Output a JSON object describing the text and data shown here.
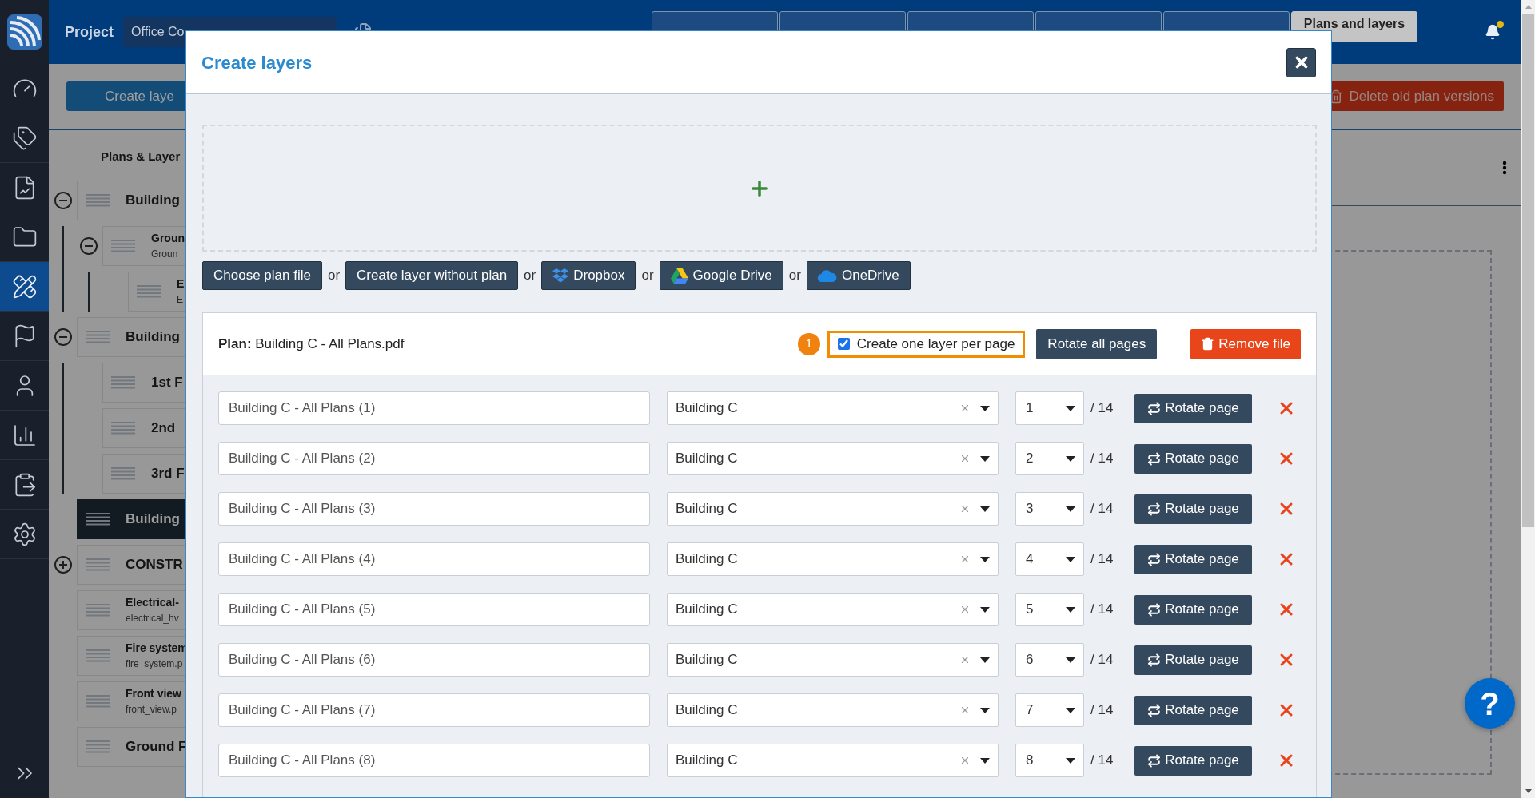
{
  "nav": {
    "items": [
      {
        "kind": "dashboard",
        "selected": false
      },
      {
        "kind": "tags",
        "selected": false
      },
      {
        "kind": "report",
        "selected": false
      },
      {
        "kind": "folder",
        "selected": false
      },
      {
        "kind": "plans",
        "selected": true
      },
      {
        "kind": "flag",
        "selected": false
      },
      {
        "kind": "user",
        "selected": false
      },
      {
        "kind": "chart",
        "selected": false
      },
      {
        "kind": "clipboard",
        "selected": false
      },
      {
        "kind": "settings",
        "selected": false
      }
    ]
  },
  "topbar": {
    "project_label": "Project",
    "project_value": "Office Co",
    "tabs": [
      {
        "selected": false
      },
      {
        "selected": false
      },
      {
        "selected": false
      },
      {
        "selected": false
      },
      {
        "selected": false
      },
      {
        "label": "Plans and layers",
        "selected": true
      }
    ],
    "notification": {
      "unread": true
    }
  },
  "toolbar": {
    "create_button": "Create laye",
    "delete_button": "Delete old plan versions"
  },
  "tree": {
    "title": "Plans & Layer",
    "items": [
      {
        "title": "Building",
        "selected": false,
        "expanded": true,
        "children": [
          {
            "title": "Groun",
            "subtitle": "Groun",
            "selected": false,
            "expanded": true,
            "children": [
              {
                "title": "E",
                "subtitle": "E",
                "selected": false
              }
            ]
          }
        ]
      },
      {
        "title": "Building",
        "selected": false,
        "expanded": true,
        "children": [
          {
            "title": "1st F",
            "selected": false
          },
          {
            "title": "2nd",
            "selected": false
          },
          {
            "title": "3rd F",
            "selected": false
          }
        ]
      },
      {
        "title": "Building",
        "selected": true
      },
      {
        "title": "CONSTR",
        "selected": false,
        "expanded": false
      },
      {
        "title": "Electrical-",
        "subtitle": "electrical_hv",
        "selected": false
      },
      {
        "title": "Fire system",
        "subtitle": "fire_system.p",
        "selected": false
      },
      {
        "title": "Front view",
        "subtitle": "front_view.p",
        "selected": false
      },
      {
        "title": "Ground F",
        "selected": false
      }
    ]
  },
  "modal": {
    "title": "Create layers",
    "sources": [
      {
        "kind": "file",
        "label": "Choose plan file"
      },
      {
        "kind": "blank",
        "label": "Create layer without plan",
        "prefix": "or"
      },
      {
        "kind": "dropbox",
        "label": "Dropbox",
        "prefix": "or"
      },
      {
        "kind": "gdrive",
        "label": "Google Drive",
        "prefix": "or"
      },
      {
        "kind": "onedrive",
        "label": "OneDrive",
        "prefix": "or"
      }
    ],
    "plan": {
      "label": "**Plan:** Building C - All Plans.pdf",
      "step_badge": "1",
      "one_layer_per_page": {
        "label": "Create one layer per page",
        "checked": true,
        "highlighted": true
      },
      "rotate_all": "Rotate all pages",
      "remove": "Remove file",
      "rows": [
        {
          "name": "Building C - All Plans (1)",
          "layer": "Building C",
          "page": "1",
          "total": "/ 14",
          "rotate": "Rotate page"
        },
        {
          "name": "Building C - All Plans (2)",
          "layer": "Building C",
          "page": "2",
          "total": "/ 14",
          "rotate": "Rotate page"
        },
        {
          "name": "Building C - All Plans (3)",
          "layer": "Building C",
          "page": "3",
          "total": "/ 14",
          "rotate": "Rotate page"
        },
        {
          "name": "Building C - All Plans (4)",
          "layer": "Building C",
          "page": "4",
          "total": "/ 14",
          "rotate": "Rotate page"
        },
        {
          "name": "Building C - All Plans (5)",
          "layer": "Building C",
          "page": "5",
          "total": "/ 14",
          "rotate": "Rotate page"
        },
        {
          "name": "Building C - All Plans (6)",
          "layer": "Building C",
          "page": "6",
          "total": "/ 14",
          "rotate": "Rotate page"
        },
        {
          "name": "Building C - All Plans (7)",
          "layer": "Building C",
          "page": "7",
          "total": "/ 14",
          "rotate": "Rotate page"
        },
        {
          "name": "Building C - All Plans (8)",
          "layer": "Building C",
          "page": "8",
          "total": "/ 14",
          "rotate": "Rotate page"
        }
      ]
    }
  },
  "help": "?"
}
